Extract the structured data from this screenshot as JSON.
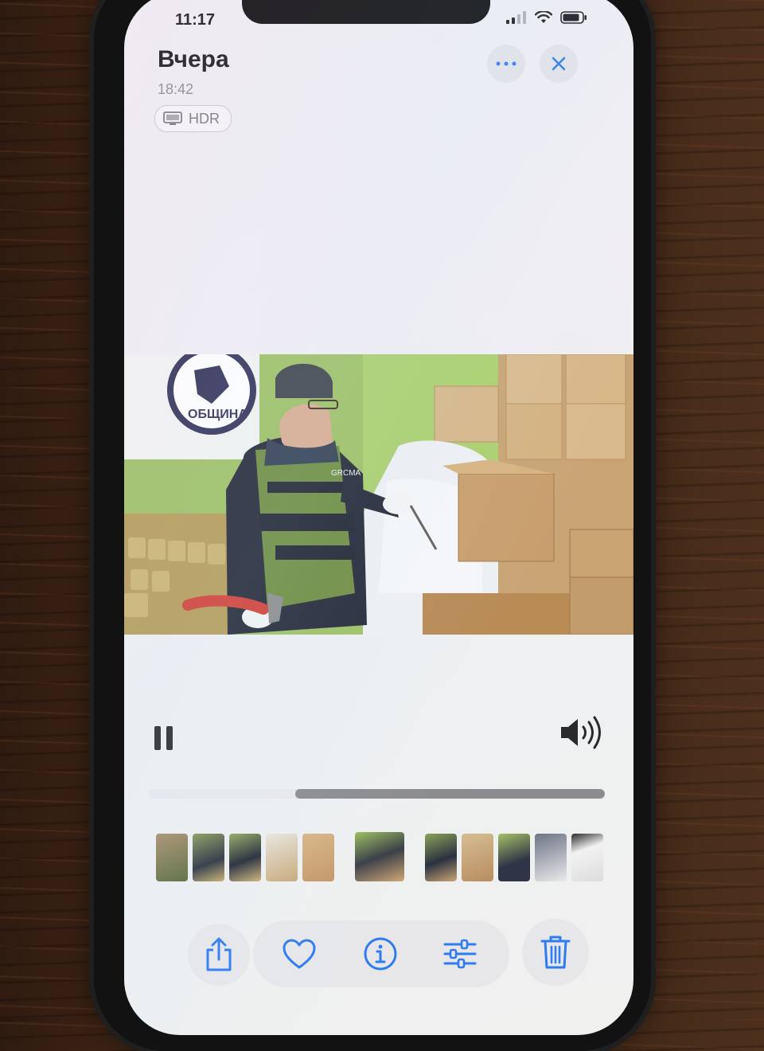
{
  "status_bar": {
    "time": "11:17"
  },
  "header": {
    "title": "Вчера",
    "time": "18:42",
    "badge": "HDR"
  },
  "photo": {
    "banner_text": "ОБЩИНА",
    "vest_text": "GRCMA"
  },
  "player": {
    "played_fraction": 0.32,
    "state": "playing"
  },
  "filmstrip": {
    "frames_before": 5,
    "frames_after": 5
  },
  "toolbar": {
    "items": [
      "share-icon",
      "heart-icon",
      "info-icon",
      "adjust-icon",
      "trash-icon"
    ]
  },
  "colors": {
    "accent": "#2f7bf0",
    "background": "#eeeef2",
    "progress_remaining": "#8c8c90"
  }
}
